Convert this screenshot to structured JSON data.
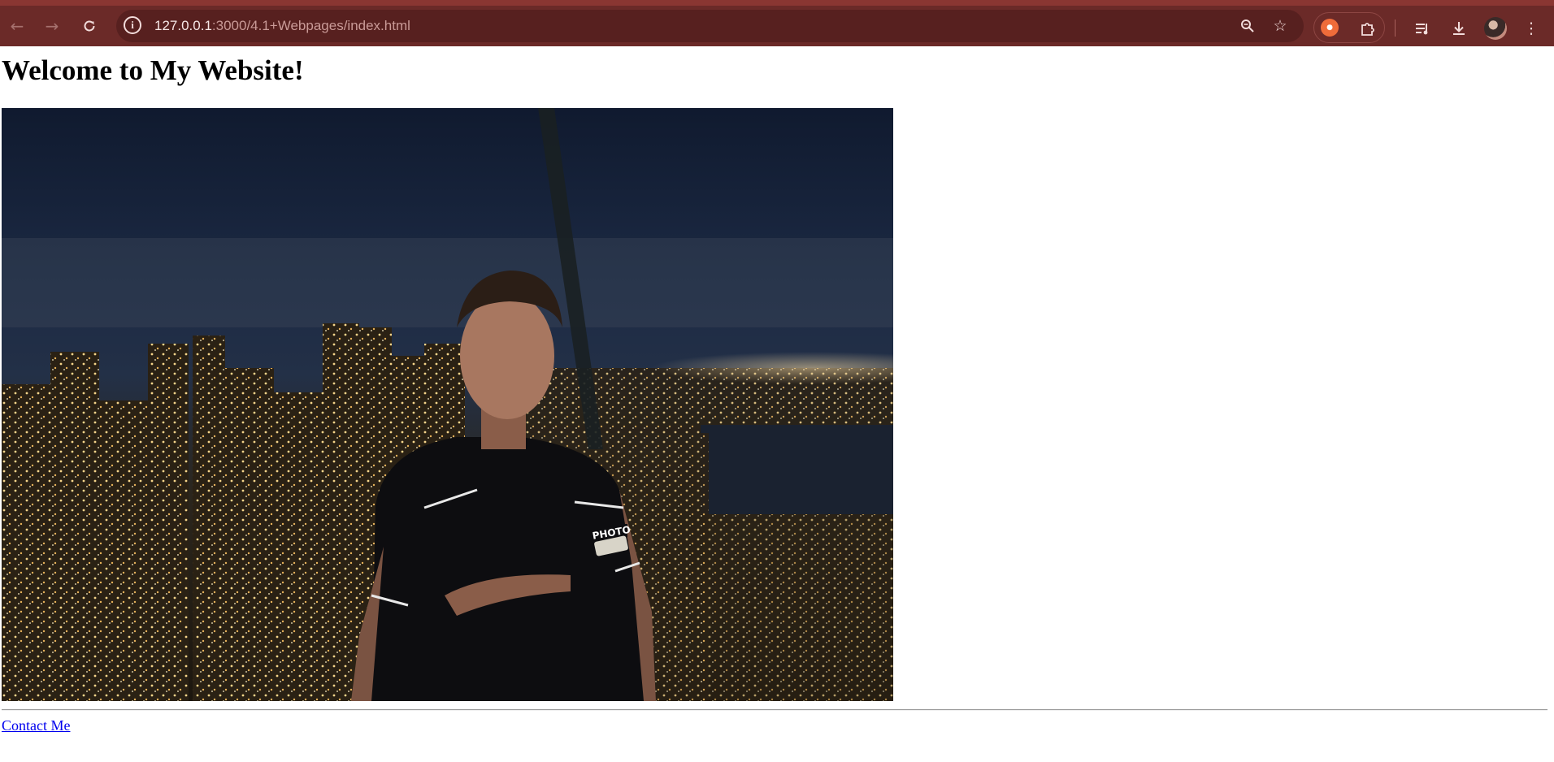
{
  "browser": {
    "url_host": "127.0.0.1",
    "url_path": ":3000/4.1+Webpages/index.html",
    "icons": {
      "back": "arrow-left-icon",
      "forward": "arrow-right-icon",
      "reload": "reload-icon",
      "site_info": "info-icon",
      "zoom": "zoom-out-icon",
      "bookmark": "star-icon",
      "extension": "extension-icon",
      "extensions_menu": "puzzle-icon",
      "media": "media-queue-icon",
      "downloads": "download-icon",
      "profile": "avatar",
      "menu": "kebab-menu-icon"
    },
    "colors": {
      "toolbar": "#6b2a28",
      "omnibox": "#57201f"
    }
  },
  "page": {
    "heading": "Welcome to My Website!",
    "contact_link": "Contact Me"
  }
}
